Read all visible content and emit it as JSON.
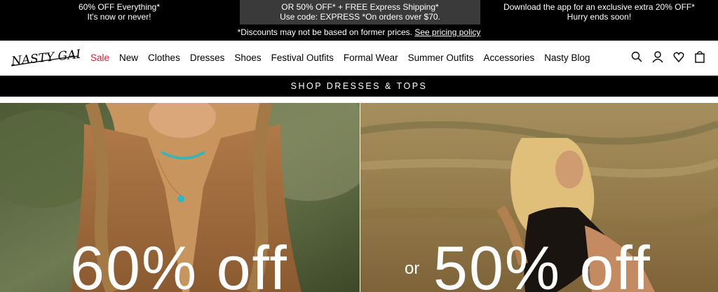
{
  "promo": {
    "left_line1": "60% OFF Everything*",
    "left_line2": "It's now or never!",
    "mid_line1": "OR 50% OFF* + FREE Express Shipping*",
    "mid_line2": "Use code: EXPRESS *On orders over $70.",
    "right_line1": "Download the app for an exclusive extra 20% OFF*",
    "right_line2": "Hurry ends soon!",
    "footnote": "*Discounts may not be based on former prices.",
    "pricing_link": "See pricing policy"
  },
  "header": {
    "logo_text": "NASTY GAL",
    "nav": [
      "Sale",
      "New",
      "Clothes",
      "Dresses",
      "Shoes",
      "Festival Outfits",
      "Formal Wear",
      "Summer Outfits",
      "Accessories",
      "Nasty Blog"
    ],
    "icons": [
      "search-icon",
      "account-icon",
      "wishlist-icon",
      "bag-icon"
    ]
  },
  "shop_bar": {
    "label": "SHOP DRESSES & TOPS"
  },
  "hero": {
    "left_text": "60% off",
    "right_prefix": "or",
    "right_text": "50% off"
  },
  "colors": {
    "black": "#000000",
    "sale_red": "#d6202e",
    "promo_mid": "#3a3a3a"
  }
}
